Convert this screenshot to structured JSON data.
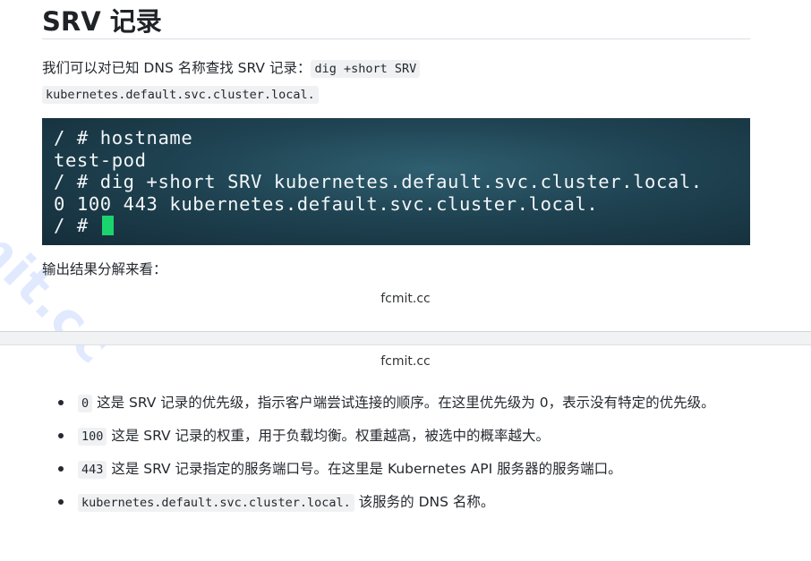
{
  "heading": "SRV 记录",
  "intro": {
    "text": "我们可以对已知 DNS 名称查找 SRV 记录：",
    "code_part1": "dig +short SRV",
    "code_part2": "kubernetes.default.svc.cluster.local."
  },
  "terminal": {
    "lines": [
      "/ # hostname",
      "test-pod",
      "/ # dig +short SRV kubernetes.default.svc.cluster.local.",
      "0 100 443 kubernetes.default.svc.cluster.local.",
      "/ # "
    ],
    "cursor_color": "#1bd46d"
  },
  "explain_intro": "输出结果分解来看：",
  "caption_top": "fcmit.cc",
  "caption_bottom": "fcmit.cc",
  "watermark": "mit.cc",
  "bullets": [
    {
      "code": "0",
      "text": " 这是 SRV 记录的优先级，指示客户端尝试连接的顺序。在这里优先级为 0，表示没有特定的优先级。"
    },
    {
      "code": "100",
      "text": " 这是 SRV 记录的权重，用于负载均衡。权重越高，被选中的概率越大。"
    },
    {
      "code": "443",
      "text": " 这是 SRV 记录指定的服务端口号。在这里是 Kubernetes API 服务器的服务端口。"
    },
    {
      "code": "kubernetes.default.svc.cluster.local.",
      "text": " 该服务的 DNS 名称。"
    }
  ]
}
